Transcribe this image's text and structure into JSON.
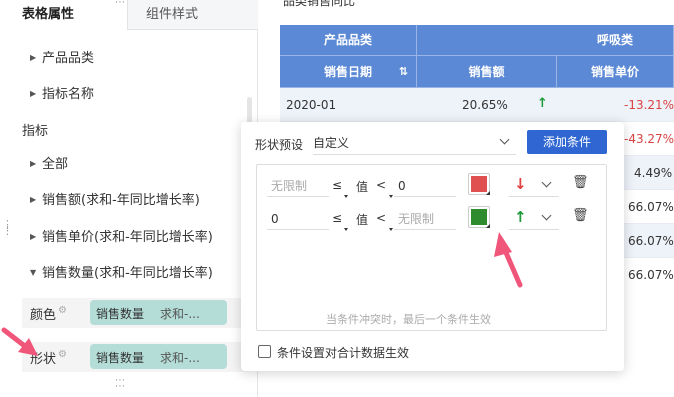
{
  "left_panel": {
    "tabs": [
      {
        "label": "表格属性"
      },
      {
        "label": "组件样式"
      }
    ],
    "tree_top": [
      {
        "label": "产品品类"
      },
      {
        "label": "指标名称"
      }
    ],
    "section_label": "指标",
    "tree_indicators": [
      {
        "label": "全部",
        "expanded": false
      },
      {
        "label": "销售额(求和-年同比增长率)",
        "expanded": false
      },
      {
        "label": "销售单价(求和-年同比增长率)",
        "expanded": false
      },
      {
        "label": "销售数量(求和-年同比增长率)",
        "expanded": true
      }
    ],
    "fields": [
      {
        "label": "颜色",
        "pill_field": "销售数量",
        "pill_agg": "求和-..."
      },
      {
        "label": "形状",
        "pill_field": "销售数量",
        "pill_agg": "求和-..."
      }
    ]
  },
  "table": {
    "title": "品类销售同比",
    "header_groups": [
      "产品品类",
      "呼吸类"
    ],
    "columns": [
      "销售日期",
      "销售额",
      "销售单价"
    ],
    "first_row": {
      "date": "2020-01",
      "sales": "20.65%",
      "price": "-13.21%"
    },
    "price_column_values": [
      "-43.27%",
      "4.49%",
      "66.07%",
      "66.07%",
      "66.07%"
    ]
  },
  "popup": {
    "preset_label": "形状预设",
    "preset_value": "自定义",
    "add_button": "添加条件",
    "conditions": [
      {
        "min_placeholder": "无限制",
        "op1": "≤",
        "val_label": "值",
        "op2": "<",
        "max": "0",
        "color": "#e05050",
        "arrow": "down",
        "arrow_color": "#e04040"
      },
      {
        "min": "0",
        "op1": "≤",
        "val_label": "值",
        "op2": "<",
        "max_placeholder": "无限制",
        "color": "#2e8b2e",
        "arrow": "up",
        "arrow_color": "#1f9a3a"
      }
    ],
    "hint": "当条件冲突时，最后一个条件生效",
    "checkbox_label": "条件设置对合计数据生效",
    "checkbox_checked": false
  },
  "colors": {
    "header_blue": "#5b89d5",
    "primary_button": "#2f66d1",
    "pill_teal": "#b4ddd8",
    "annotation_pink": "#f0557a"
  }
}
